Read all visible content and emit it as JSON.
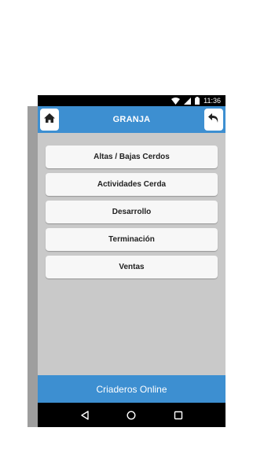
{
  "status_bar": {
    "time": "11:36"
  },
  "app_bar": {
    "title": "GRANJA"
  },
  "menu": {
    "items": [
      {
        "label": "Altas / Bajas Cerdos"
      },
      {
        "label": "Actividades Cerda"
      },
      {
        "label": "Desarrollo"
      },
      {
        "label": "Terminación"
      },
      {
        "label": "Ventas"
      }
    ]
  },
  "footer": {
    "text": "Criaderos Online"
  },
  "colors": {
    "accent": "#3d8fd1",
    "background": "#c9c9c9",
    "button": "#f7f7f7"
  },
  "icons": {
    "home": "home-icon",
    "back": "back-arrow-icon",
    "nav_back": "triangle-back-icon",
    "nav_home": "circle-home-icon",
    "nav_recents": "square-recents-icon"
  }
}
